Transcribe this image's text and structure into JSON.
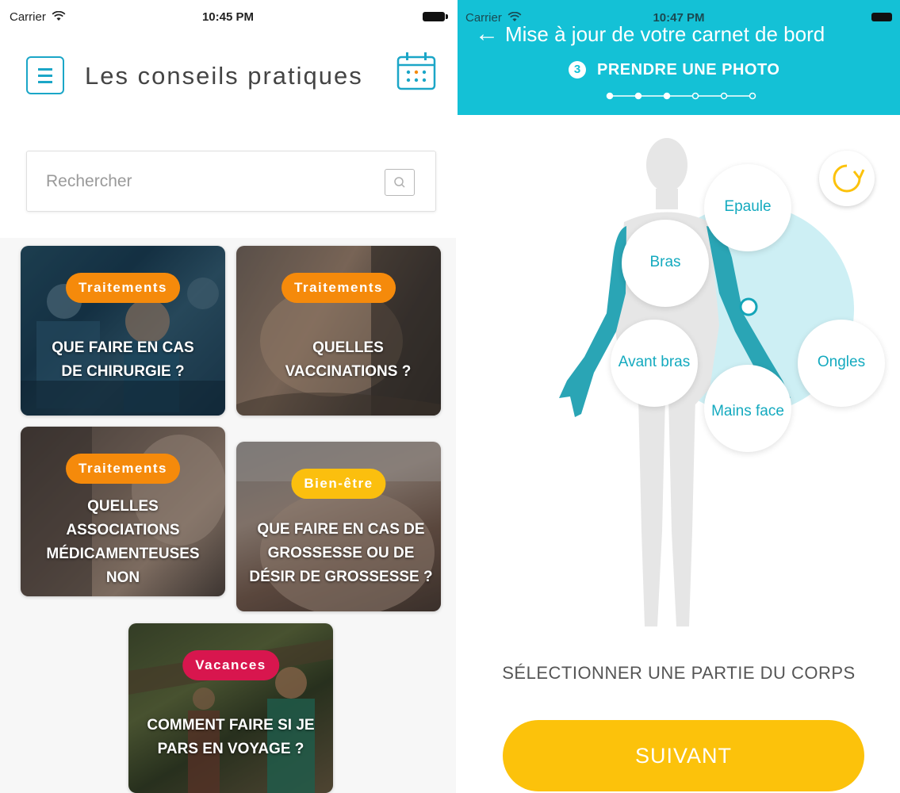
{
  "left_screen": {
    "status": {
      "carrier": "Carrier",
      "time": "10:45 PM"
    },
    "title": "Les conseils pratiques",
    "search": {
      "placeholder": "Rechercher"
    },
    "cards": [
      {
        "tag": "Traitements",
        "title": "QUE FAIRE EN CAS DE CHIRURGIE ?"
      },
      {
        "tag": "Traitements",
        "title": "QUELLES VACCINATIONS ?"
      },
      {
        "tag": "Traitements",
        "title": "QUELLES ASSOCIATIONS MÉDICAMENTEUSES NON"
      },
      {
        "tag": "Bien-être",
        "title": "QUE FAIRE EN CAS DE GROSSESSE OU DE DÉSIR DE GROSSESSE ?"
      },
      {
        "tag": "Vacances",
        "title": "COMMENT FAIRE SI JE PARS EN VOYAGE ?"
      }
    ],
    "colors": {
      "traitements": "#f58a0b",
      "bien_etre": "#fbbf0e",
      "vacances": "#d8164e",
      "accent": "#1ba6c7"
    }
  },
  "right_screen": {
    "status": {
      "carrier": "Carrier",
      "time": "10:47 PM"
    },
    "header_title": "Mise à jour de votre carnet de bord",
    "step": {
      "number": "3",
      "label": "PRENDRE UNE PHOTO",
      "current": 3,
      "total": 6
    },
    "body_parts": [
      "Epaule",
      "Bras",
      "Avant bras",
      "Ongles",
      "Mains face"
    ],
    "instruction": "SÉLECTIONNER UNE PARTIE DU CORPS",
    "next_label": "SUIVANT",
    "colors": {
      "header": "#14c1d6",
      "button": "#fcc20b",
      "body_highlight": "#2aa5b5"
    }
  }
}
